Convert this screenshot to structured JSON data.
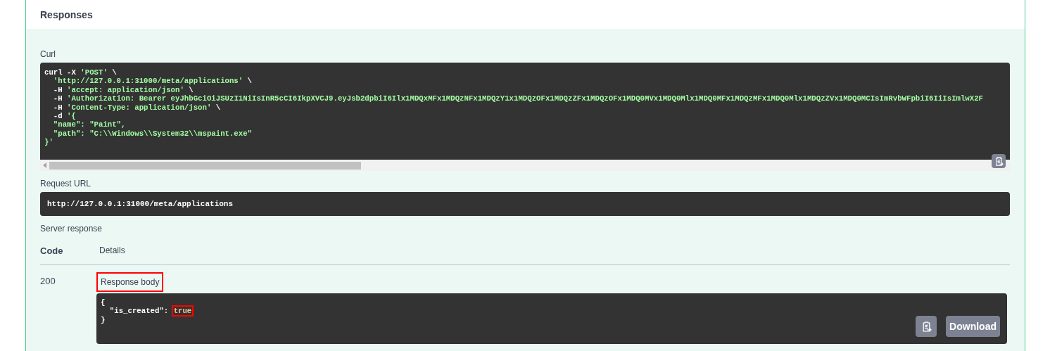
{
  "header": {
    "title": "Responses"
  },
  "curl": {
    "label": "Curl",
    "lines": [
      [
        {
          "kind": "plain",
          "text": "curl -X "
        },
        {
          "kind": "string",
          "text": "'POST'"
        },
        {
          "kind": "plain",
          "text": " \\"
        }
      ],
      [
        {
          "kind": "string",
          "text": "  'http://127.0.0.1:31000/meta/applications'"
        },
        {
          "kind": "plain",
          "text": " \\"
        }
      ],
      [
        {
          "kind": "plain",
          "text": "  -H "
        },
        {
          "kind": "string",
          "text": "'accept: application/json'"
        },
        {
          "kind": "plain",
          "text": " \\"
        }
      ],
      [
        {
          "kind": "plain",
          "text": "  -H "
        },
        {
          "kind": "string",
          "text": "'Authorization: Bearer eyJhbGciOiJSUzI1NiIsInR5cCI6IkpXVCJ9.eyJsb2dpbiI6Ilx1MDQxMFx1MDQzNFx1MDQzY1x1MDQzOFx1MDQzZFx1MDQzOFx1MDQ0MVx1MDQ0Mlx1MDQ0MFx1MDQzMFx1MDQ0Mlx1MDQzZVx1MDQ0MCIsImRvbWFpbiI6IiIsImlwX2F"
        }
      ],
      [
        {
          "kind": "plain",
          "text": "  -H "
        },
        {
          "kind": "string",
          "text": "'Content-Type: application/json'"
        },
        {
          "kind": "plain",
          "text": " \\"
        }
      ],
      [
        {
          "kind": "plain",
          "text": "  -d "
        },
        {
          "kind": "string",
          "text": "'{"
        }
      ],
      [
        {
          "kind": "string",
          "text": "  \"name\": \"Paint\","
        }
      ],
      [
        {
          "kind": "string",
          "text": "  \"path\": \"C:\\\\Windows\\\\System32\\\\mspaint.exe\""
        }
      ],
      [
        {
          "kind": "string",
          "text": "}'"
        }
      ]
    ]
  },
  "request_url": {
    "label": "Request URL",
    "value": "http://127.0.0.1:31000/meta/applications"
  },
  "server_response": {
    "label": "Server response",
    "columns": [
      "Code",
      "Details"
    ],
    "rows": [
      {
        "code": "200",
        "body_label": "Response body",
        "body_label_highlighted": true,
        "body_lines": [
          [
            {
              "kind": "plain",
              "text": "{"
            }
          ],
          [
            {
              "kind": "plain",
              "text": "  \"is_created\": "
            },
            {
              "kind": "literal",
              "text": "true",
              "highlighted": true
            }
          ],
          [
            {
              "kind": "plain",
              "text": "}"
            }
          ]
        ],
        "download": "Download"
      }
    ]
  }
}
